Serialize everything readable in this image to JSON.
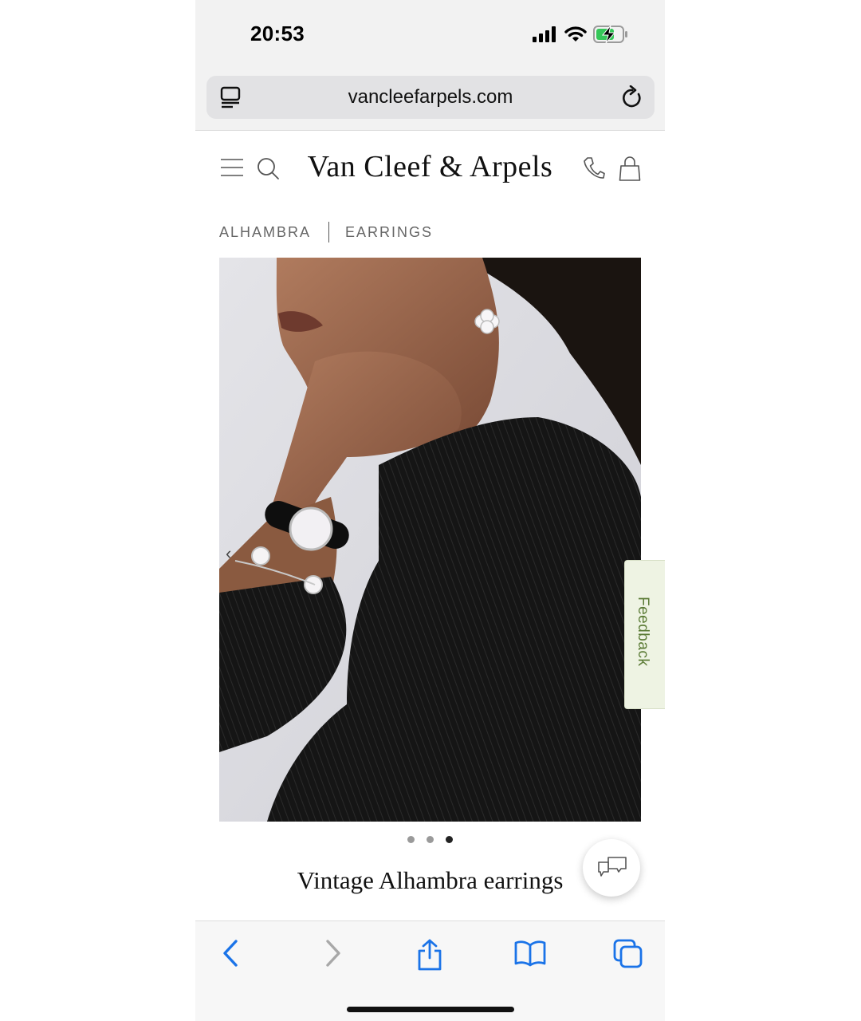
{
  "status_bar": {
    "time": "20:53"
  },
  "browser": {
    "url": "vancleefarpels.com"
  },
  "site": {
    "brand": "Van Cleef & Arpels",
    "breadcrumb": [
      "ALHAMBRA",
      "EARRINGS"
    ]
  },
  "carousel": {
    "slide_count": 3,
    "active_index": 2
  },
  "product": {
    "title": "Vintage Alhambra earrings"
  },
  "feedback": {
    "label": "Feedback"
  },
  "colors": {
    "accent_blue": "#1a73e8",
    "feedback_bg": "#eef3e3",
    "feedback_text": "#5a7a34",
    "battery_green": "#35c759"
  },
  "icons": {
    "header": [
      "menu-icon",
      "search-icon",
      "phone-icon",
      "shopping-bag-icon"
    ],
    "toolbar": [
      "back-icon",
      "forward-icon",
      "share-icon",
      "bookmarks-icon",
      "tabs-icon"
    ]
  }
}
